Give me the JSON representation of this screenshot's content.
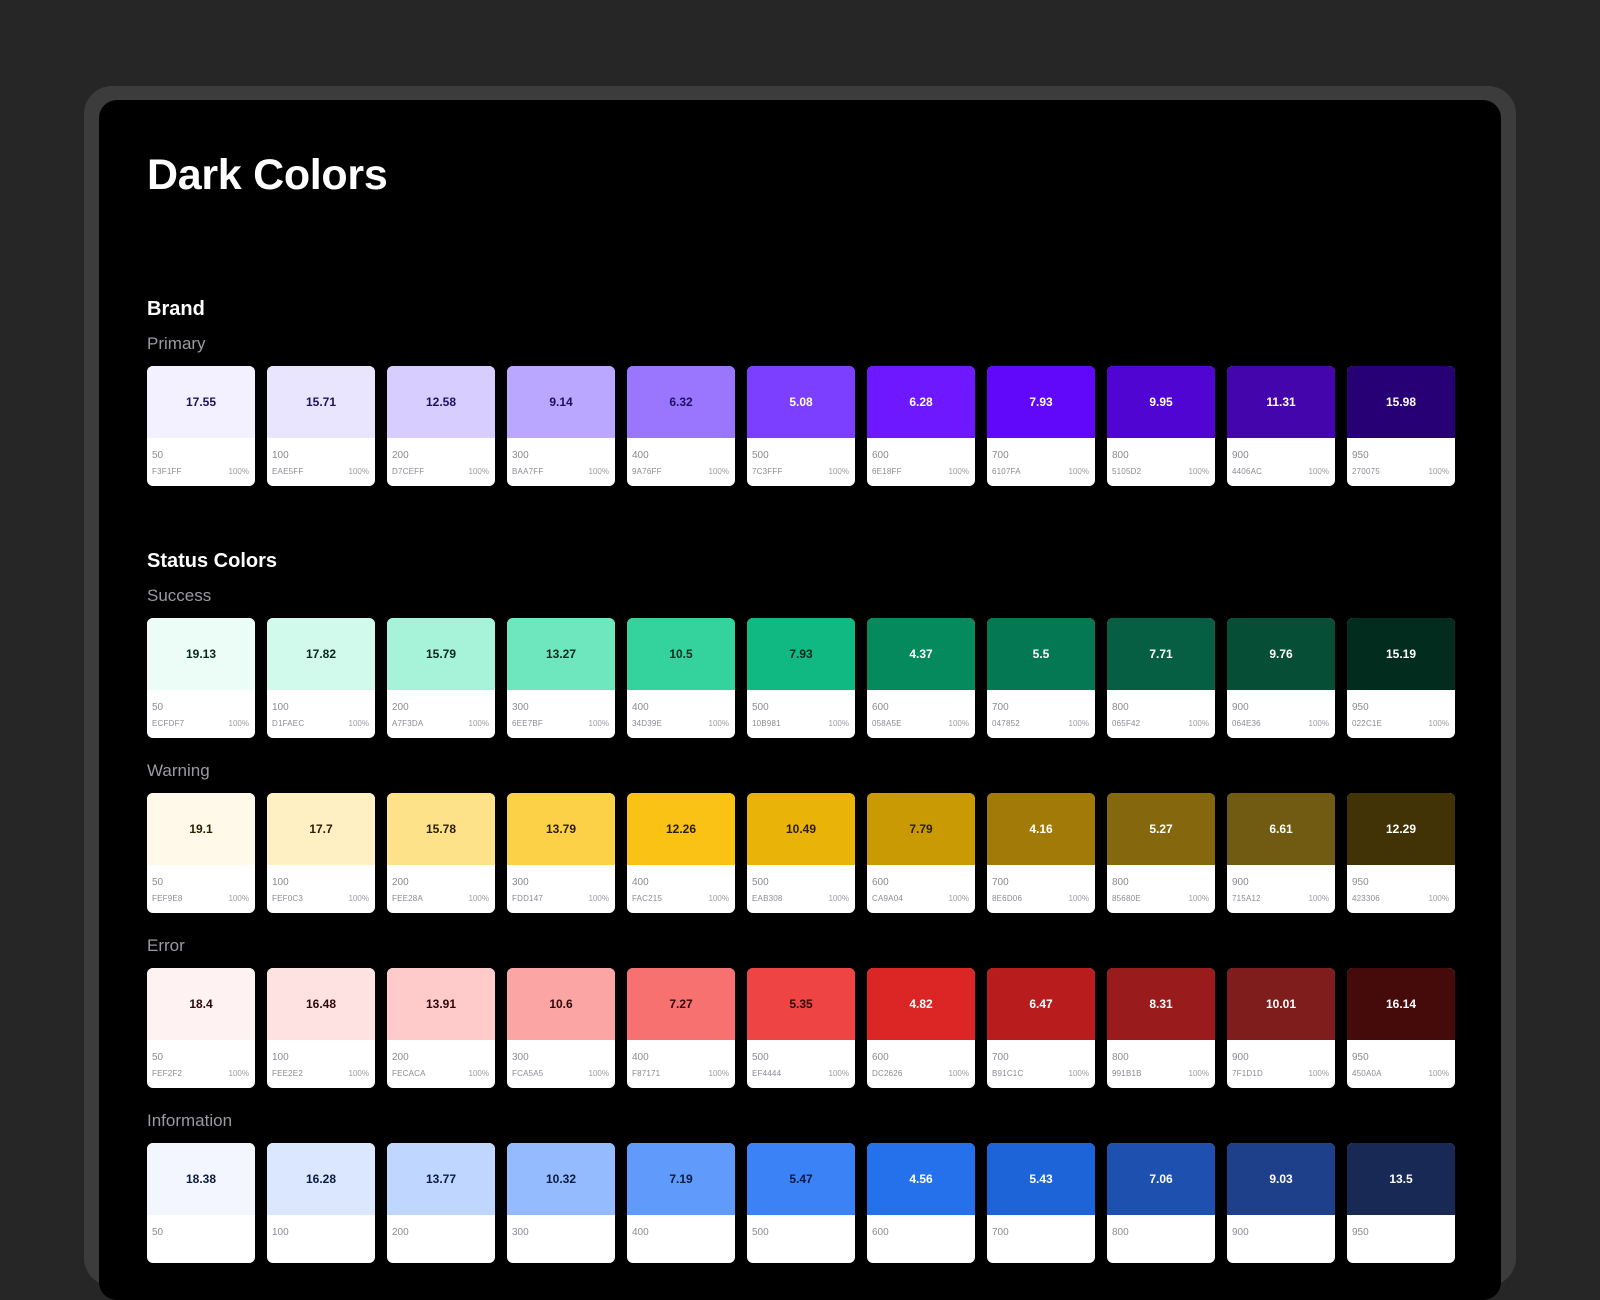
{
  "page": {
    "title": "Dark Colors"
  },
  "sections": [
    {
      "title": "Brand",
      "groups": [
        {
          "title": "Primary",
          "swatches": [
            {
              "step": "50",
              "hex": "F3F1FF",
              "opacity": "100%",
              "contrast": "17.55",
              "color": "#F3F1FF",
              "text_color": "#1e1060"
            },
            {
              "step": "100",
              "hex": "EAE5FF",
              "opacity": "100%",
              "contrast": "15.71",
              "color": "#EAE5FF",
              "text_color": "#1e1060"
            },
            {
              "step": "200",
              "hex": "D7CEFF",
              "opacity": "100%",
              "contrast": "12.58",
              "color": "#D7CEFF",
              "text_color": "#1e1060"
            },
            {
              "step": "300",
              "hex": "BAA7FF",
              "opacity": "100%",
              "contrast": "9.14",
              "color": "#BAA7FF",
              "text_color": "#1e1060"
            },
            {
              "step": "400",
              "hex": "9A76FF",
              "opacity": "100%",
              "contrast": "6.32",
              "color": "#9A76FF",
              "text_color": "#1e1060"
            },
            {
              "step": "500",
              "hex": "7C3FFF",
              "opacity": "100%",
              "contrast": "5.08",
              "color": "#7C3FFF",
              "text_color": "#ffffff"
            },
            {
              "step": "600",
              "hex": "6E18FF",
              "opacity": "100%",
              "contrast": "6.28",
              "color": "#6E18FF",
              "text_color": "#ffffff"
            },
            {
              "step": "700",
              "hex": "6107FA",
              "opacity": "100%",
              "contrast": "7.93",
              "color": "#6107FA",
              "text_color": "#ffffff"
            },
            {
              "step": "800",
              "hex": "5105D2",
              "opacity": "100%",
              "contrast": "9.95",
              "color": "#5105D2",
              "text_color": "#ffffff"
            },
            {
              "step": "900",
              "hex": "4406AC",
              "opacity": "100%",
              "contrast": "11.31",
              "color": "#4406AC",
              "text_color": "#ffffff"
            },
            {
              "step": "950",
              "hex": "270075",
              "opacity": "100%",
              "contrast": "15.98",
              "color": "#270075",
              "text_color": "#ffffff"
            }
          ]
        }
      ]
    },
    {
      "title": "Status Colors",
      "groups": [
        {
          "title": "Success",
          "swatches": [
            {
              "step": "50",
              "hex": "ECFDF7",
              "opacity": "100%",
              "contrast": "19.13",
              "color": "#ECFDF7",
              "text_color": "#06281c"
            },
            {
              "step": "100",
              "hex": "D1FAEC",
              "opacity": "100%",
              "contrast": "17.82",
              "color": "#D1FAEC",
              "text_color": "#06281c"
            },
            {
              "step": "200",
              "hex": "A7F3DA",
              "opacity": "100%",
              "contrast": "15.79",
              "color": "#A7F3DA",
              "text_color": "#06281c"
            },
            {
              "step": "300",
              "hex": "6EE7BF",
              "opacity": "100%",
              "contrast": "13.27",
              "color": "#6EE7BF",
              "text_color": "#06281c"
            },
            {
              "step": "400",
              "hex": "34D39E",
              "opacity": "100%",
              "contrast": "10.5",
              "color": "#34D39E",
              "text_color": "#06281c"
            },
            {
              "step": "500",
              "hex": "10B981",
              "opacity": "100%",
              "contrast": "7.93",
              "color": "#10B981",
              "text_color": "#06281c"
            },
            {
              "step": "600",
              "hex": "058A5E",
              "opacity": "100%",
              "contrast": "4.37",
              "color": "#058A5E",
              "text_color": "#ffffff"
            },
            {
              "step": "700",
              "hex": "047852",
              "opacity": "100%",
              "contrast": "5.5",
              "color": "#047852",
              "text_color": "#ffffff"
            },
            {
              "step": "800",
              "hex": "065F42",
              "opacity": "100%",
              "contrast": "7.71",
              "color": "#065F42",
              "text_color": "#ffffff"
            },
            {
              "step": "900",
              "hex": "064E36",
              "opacity": "100%",
              "contrast": "9.76",
              "color": "#064E36",
              "text_color": "#ffffff"
            },
            {
              "step": "950",
              "hex": "022C1E",
              "opacity": "100%",
              "contrast": "15.19",
              "color": "#022C1E",
              "text_color": "#ffffff"
            }
          ]
        },
        {
          "title": "Warning",
          "swatches": [
            {
              "step": "50",
              "hex": "FEF9E8",
              "opacity": "100%",
              "contrast": "19.1",
              "color": "#FEF9E8",
              "text_color": "#2a1e02"
            },
            {
              "step": "100",
              "hex": "FEF0C3",
              "opacity": "100%",
              "contrast": "17.7",
              "color": "#FEF0C3",
              "text_color": "#2a1e02"
            },
            {
              "step": "200",
              "hex": "FEE28A",
              "opacity": "100%",
              "contrast": "15.78",
              "color": "#FEE28A",
              "text_color": "#2a1e02"
            },
            {
              "step": "300",
              "hex": "FDD147",
              "opacity": "100%",
              "contrast": "13.79",
              "color": "#FDD147",
              "text_color": "#2a1e02"
            },
            {
              "step": "400",
              "hex": "FAC215",
              "opacity": "100%",
              "contrast": "12.26",
              "color": "#FAC215",
              "text_color": "#2a1e02"
            },
            {
              "step": "500",
              "hex": "EAB308",
              "opacity": "100%",
              "contrast": "10.49",
              "color": "#EAB308",
              "text_color": "#2a1e02"
            },
            {
              "step": "600",
              "hex": "CA9A04",
              "opacity": "100%",
              "contrast": "7.79",
              "color": "#CA9A04",
              "text_color": "#2a1e02"
            },
            {
              "step": "700",
              "hex": "8E6D06",
              "opacity": "100%",
              "contrast": "4.16",
              "color": "#A17A07",
              "text_color": "#ffffff"
            },
            {
              "step": "800",
              "hex": "85680E",
              "opacity": "100%",
              "contrast": "5.27",
              "color": "#85680E",
              "text_color": "#ffffff"
            },
            {
              "step": "900",
              "hex": "715A12",
              "opacity": "100%",
              "contrast": "6.61",
              "color": "#715A12",
              "text_color": "#ffffff"
            },
            {
              "step": "950",
              "hex": "423306",
              "opacity": "100%",
              "contrast": "12.29",
              "color": "#423306",
              "text_color": "#ffffff"
            }
          ]
        },
        {
          "title": "Error",
          "swatches": [
            {
              "step": "50",
              "hex": "FEF2F2",
              "opacity": "100%",
              "contrast": "18.4",
              "color": "#FEF2F2",
              "text_color": "#2e0808"
            },
            {
              "step": "100",
              "hex": "FEE2E2",
              "opacity": "100%",
              "contrast": "16.48",
              "color": "#FEE2E2",
              "text_color": "#2e0808"
            },
            {
              "step": "200",
              "hex": "FECACA",
              "opacity": "100%",
              "contrast": "13.91",
              "color": "#FECACA",
              "text_color": "#2e0808"
            },
            {
              "step": "300",
              "hex": "FCA5A5",
              "opacity": "100%",
              "contrast": "10.6",
              "color": "#FCA5A5",
              "text_color": "#2e0808"
            },
            {
              "step": "400",
              "hex": "F87171",
              "opacity": "100%",
              "contrast": "7.27",
              "color": "#F87171",
              "text_color": "#2e0808"
            },
            {
              "step": "500",
              "hex": "EF4444",
              "opacity": "100%",
              "contrast": "5.35",
              "color": "#EF4444",
              "text_color": "#2e0808"
            },
            {
              "step": "600",
              "hex": "DC2626",
              "opacity": "100%",
              "contrast": "4.82",
              "color": "#DC2626",
              "text_color": "#ffffff"
            },
            {
              "step": "700",
              "hex": "B91C1C",
              "opacity": "100%",
              "contrast": "6.47",
              "color": "#B91C1C",
              "text_color": "#ffffff"
            },
            {
              "step": "800",
              "hex": "991B1B",
              "opacity": "100%",
              "contrast": "8.31",
              "color": "#991B1B",
              "text_color": "#ffffff"
            },
            {
              "step": "900",
              "hex": "7F1D1D",
              "opacity": "100%",
              "contrast": "10.01",
              "color": "#7F1D1D",
              "text_color": "#ffffff"
            },
            {
              "step": "950",
              "hex": "450A0A",
              "opacity": "100%",
              "contrast": "16.14",
              "color": "#450A0A",
              "text_color": "#ffffff"
            }
          ]
        },
        {
          "title": "Information",
          "swatches": [
            {
              "step": "50",
              "hex": "",
              "opacity": "",
              "contrast": "18.38",
              "color": "#F3F6FE",
              "text_color": "#0c1a40"
            },
            {
              "step": "100",
              "hex": "",
              "opacity": "",
              "contrast": "16.28",
              "color": "#DBE7FE",
              "text_color": "#0c1a40"
            },
            {
              "step": "200",
              "hex": "",
              "opacity": "",
              "contrast": "13.77",
              "color": "#BFD7FE",
              "text_color": "#0c1a40"
            },
            {
              "step": "300",
              "hex": "",
              "opacity": "",
              "contrast": "10.32",
              "color": "#93BBFD",
              "text_color": "#0c1a40"
            },
            {
              "step": "400",
              "hex": "",
              "opacity": "",
              "contrast": "7.19",
              "color": "#609AFA",
              "text_color": "#0c1a40"
            },
            {
              "step": "500",
              "hex": "",
              "opacity": "",
              "contrast": "5.47",
              "color": "#3B82F6",
              "text_color": "#0c1a40"
            },
            {
              "step": "600",
              "hex": "",
              "opacity": "",
              "contrast": "4.56",
              "color": "#2570EB",
              "text_color": "#ffffff"
            },
            {
              "step": "700",
              "hex": "",
              "opacity": "",
              "contrast": "5.43",
              "color": "#1D64D8",
              "text_color": "#ffffff"
            },
            {
              "step": "800",
              "hex": "",
              "opacity": "",
              "contrast": "7.06",
              "color": "#1E50AF",
              "text_color": "#ffffff"
            },
            {
              "step": "900",
              "hex": "",
              "opacity": "",
              "contrast": "9.03",
              "color": "#1E408A",
              "text_color": "#ffffff"
            },
            {
              "step": "950",
              "hex": "",
              "opacity": "",
              "contrast": "13.5",
              "color": "#172954",
              "text_color": "#ffffff"
            }
          ]
        }
      ]
    }
  ]
}
